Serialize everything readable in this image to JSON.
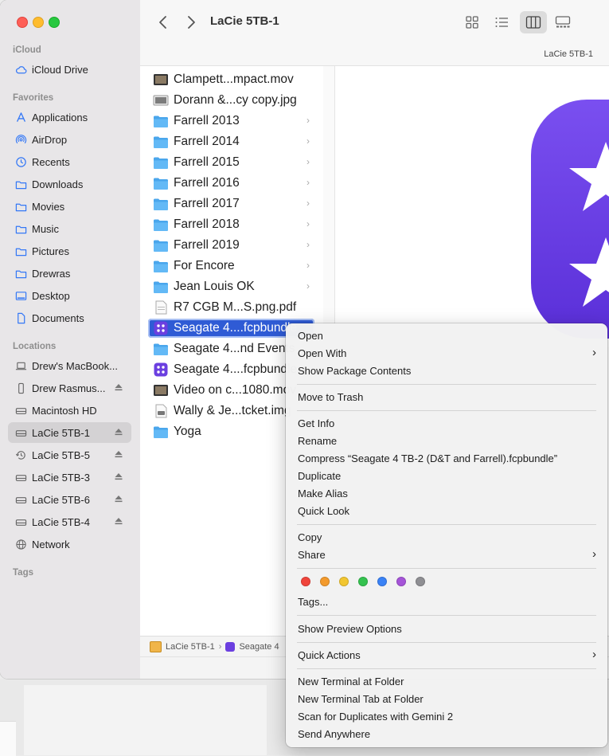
{
  "sidebar": {
    "sections": {
      "icloud": "iCloud",
      "favorites": "Favorites",
      "locations": "Locations",
      "tags": "Tags"
    },
    "icloud_items": [
      {
        "label": "iCloud Drive",
        "icon": "cloud-icon"
      }
    ],
    "favorites": [
      {
        "label": "Applications",
        "icon": "applications-icon"
      },
      {
        "label": "AirDrop",
        "icon": "airdrop-icon"
      },
      {
        "label": "Recents",
        "icon": "clock-icon"
      },
      {
        "label": "Downloads",
        "icon": "folder-icon"
      },
      {
        "label": "Movies",
        "icon": "folder-icon"
      },
      {
        "label": "Music",
        "icon": "folder-icon"
      },
      {
        "label": "Pictures",
        "icon": "folder-icon"
      },
      {
        "label": "Drewras",
        "icon": "folder-icon"
      },
      {
        "label": "Desktop",
        "icon": "desktop-icon"
      },
      {
        "label": "Documents",
        "icon": "document-icon"
      }
    ],
    "locations": [
      {
        "label": "Drew's MacBook...",
        "icon": "laptop-icon"
      },
      {
        "label": "Drew Rasmus...",
        "icon": "phone-icon",
        "eject": true
      },
      {
        "label": "Macintosh HD",
        "icon": "drive-icon"
      },
      {
        "label": "LaCie 5TB-1",
        "icon": "drive-icon",
        "eject": true,
        "active": true
      },
      {
        "label": "LaCie 5TB-5",
        "icon": "timemachine-icon",
        "eject": true
      },
      {
        "label": "LaCie 5TB-3",
        "icon": "drive-icon",
        "eject": true
      },
      {
        "label": "LaCie 5TB-6",
        "icon": "drive-icon",
        "eject": true
      },
      {
        "label": "LaCie 5TB-4",
        "icon": "drive-icon",
        "eject": true
      },
      {
        "label": "Network",
        "icon": "network-icon"
      }
    ]
  },
  "toolbar": {
    "title": "LaCie 5TB-1"
  },
  "column_header": "LaCie 5TB-1",
  "files": [
    {
      "label": "Clampett...mpact.mov",
      "icon": "video-icon"
    },
    {
      "label": "Dorann &...cy copy.jpg",
      "icon": "image-icon"
    },
    {
      "label": "Farrell 2013",
      "icon": "folder-icon",
      "folder": true
    },
    {
      "label": "Farrell 2014",
      "icon": "folder-icon",
      "folder": true
    },
    {
      "label": "Farrell 2015",
      "icon": "folder-icon",
      "folder": true
    },
    {
      "label": "Farrell 2016",
      "icon": "folder-icon",
      "folder": true
    },
    {
      "label": "Farrell 2017",
      "icon": "folder-icon",
      "folder": true
    },
    {
      "label": "Farrell 2018",
      "icon": "folder-icon",
      "folder": true
    },
    {
      "label": "Farrell 2019",
      "icon": "folder-icon",
      "folder": true
    },
    {
      "label": "For Encore",
      "icon": "folder-icon",
      "folder": true
    },
    {
      "label": "Jean Louis OK",
      "icon": "folder-icon",
      "folder": true
    },
    {
      "label": "R7 CGB M...S.png.pdf",
      "icon": "pdf-icon"
    },
    {
      "label": "Seagate 4....fcpbundle",
      "icon": "fcp-bundle-icon",
      "selected": true
    },
    {
      "label": "Seagate 4...nd Events",
      "icon": "folder-icon"
    },
    {
      "label": "Seagate 4....fcpbundle",
      "icon": "fcp-bundle-icon"
    },
    {
      "label": "Video on c...1080.mov",
      "icon": "video-icon"
    },
    {
      "label": "Wally & Je...tcket.img",
      "icon": "disk-image-icon"
    },
    {
      "label": "Yoga",
      "icon": "folder-icon"
    }
  ],
  "pathbar": {
    "root": "LaCie 5TB-1",
    "separator": "›",
    "item": "Seagate 4"
  },
  "context_menu": {
    "open": "Open",
    "open_with": "Open With",
    "show_package_contents": "Show Package Contents",
    "move_to_trash": "Move to Trash",
    "get_info": "Get Info",
    "rename": "Rename",
    "compress": "Compress “Seagate 4 TB-2 (D&T and Farrell).fcpbundle”",
    "duplicate": "Duplicate",
    "make_alias": "Make Alias",
    "quick_look": "Quick Look",
    "copy": "Copy",
    "share": "Share",
    "tags_colors": [
      "#f0443b",
      "#f39a2c",
      "#f2c630",
      "#34c24f",
      "#3a82f6",
      "#a554d8",
      "#8f8f93"
    ],
    "tags": "Tags...",
    "show_preview_options": "Show Preview Options",
    "quick_actions": "Quick Actions",
    "new_terminal": "New Terminal at Folder",
    "new_terminal_tab": "New Terminal Tab at Folder",
    "scan_duplicates": "Scan for Duplicates with Gemini 2",
    "send_anywhere": "Send Anywhere"
  },
  "colors": {
    "accent": "#2f5bd5",
    "folder": "#4aa6ec",
    "fcp_purple": "#6b3fe0"
  }
}
